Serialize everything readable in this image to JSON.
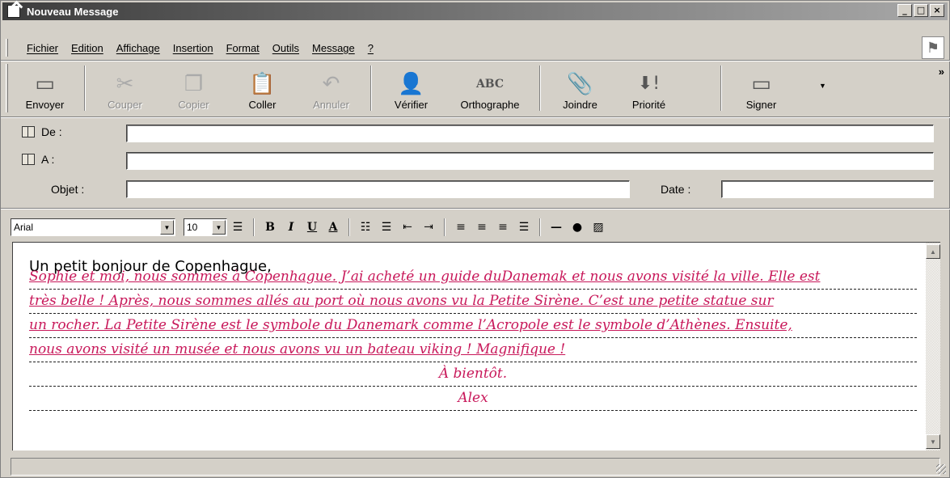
{
  "window": {
    "title": "Nouveau Message"
  },
  "menu": [
    "Fichier",
    "Edition",
    "Affichage",
    "Insertion",
    "Format",
    "Outils",
    "Message",
    "?"
  ],
  "toolbar": [
    {
      "label": "Envoyer",
      "icon": "send-icon",
      "glyph": "▭",
      "disabled": false
    },
    {
      "label": "Couper",
      "icon": "scissors-icon",
      "glyph": "✂",
      "disabled": true
    },
    {
      "label": "Copier",
      "icon": "copy-icon",
      "glyph": "❐",
      "disabled": true
    },
    {
      "label": "Coller",
      "icon": "paste-icon",
      "glyph": "📋",
      "disabled": false
    },
    {
      "label": "Annuler",
      "icon": "undo-icon",
      "glyph": "↶",
      "disabled": true
    },
    {
      "label": "Vérifier",
      "icon": "check-names-icon",
      "glyph": "👤",
      "disabled": false
    },
    {
      "label": "Orthographe",
      "icon": "spellcheck-icon",
      "glyph": "ABC",
      "disabled": false
    },
    {
      "label": "Joindre",
      "icon": "paperclip-icon",
      "glyph": "📎",
      "disabled": false
    },
    {
      "label": "Priorité",
      "icon": "priority-icon",
      "glyph": "⬇!",
      "disabled": false
    },
    {
      "label": "Signer",
      "icon": "sign-icon",
      "glyph": "▭",
      "disabled": false
    }
  ],
  "header": {
    "from_label": "De :",
    "to_label": "A :",
    "subject_label": "Objet :",
    "date_label": "Date :",
    "from_value": "",
    "to_value": "",
    "subject_value": "",
    "date_value": ""
  },
  "format": {
    "font": "Arial",
    "size": "10"
  },
  "message": {
    "greeting": "Un petit bonjour de Copenhague,",
    "lines": [
      "Sophie et moi, nous sommes à Copenhague. J’ai acheté un guide duDanemak et nous avons visité la ville. Elle est",
      "très belle ! Après, nous sommes allés au port où nous avons vu la Petite Sirène. C’est une petite statue sur",
      "un rocher. La Petite Sirène est le symbole du Danemark comme l’Acropole est le symbole d’Athènes. Ensuite,",
      "nous avons visité un musée et nous avons vu un bateau viking ! Magnifique !"
    ],
    "closing": "À bientôt.",
    "signature": "Alex"
  },
  "colors": {
    "handwriting": "#c8185a"
  }
}
